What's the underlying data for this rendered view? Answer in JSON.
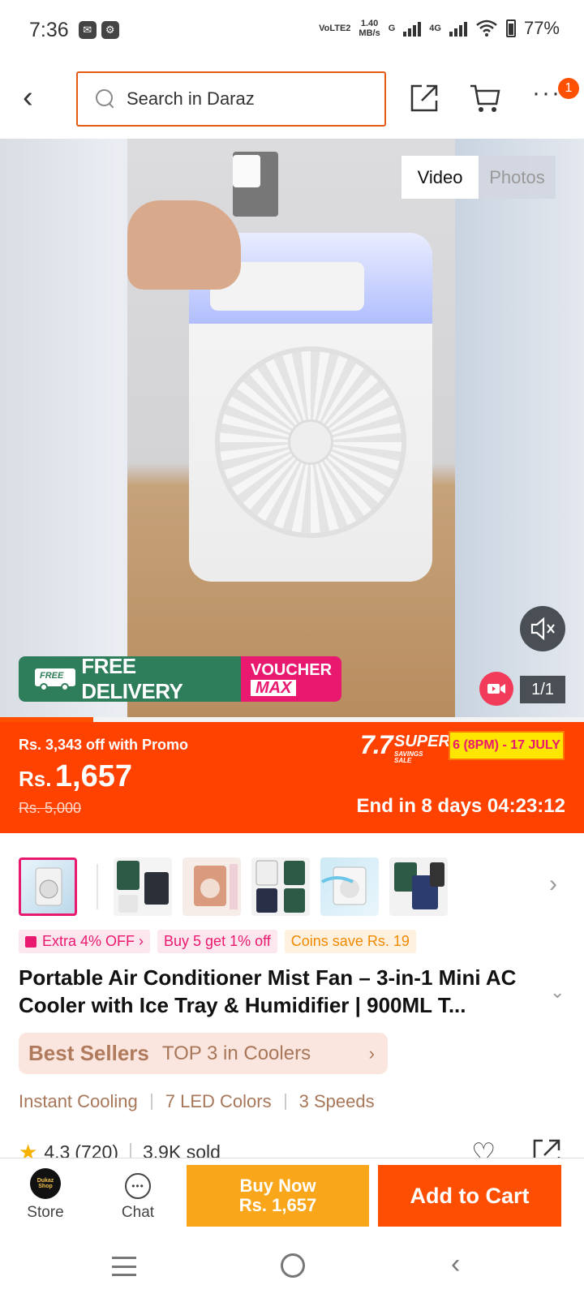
{
  "status_bar": {
    "time": "7:36",
    "volte": "VoLTE2",
    "speed_value": "1.40",
    "speed_unit": "MB/s",
    "net_g": "G",
    "net_4g": "4G",
    "battery": "77%"
  },
  "header": {
    "search_placeholder": "Search in Daraz",
    "cart_badge": "1"
  },
  "media": {
    "tab_video": "Video",
    "tab_photos": "Photos",
    "counter": "1/1",
    "promo_free_truck_text": "FREE",
    "promo_free_label": "FREE DELIVERY",
    "promo_voucher_label": "VOUCHER",
    "promo_voucher_max": "MAX",
    "gallery_progress": 0.16
  },
  "price": {
    "promo_text": "Rs. 3,343 off with Promo",
    "currency": "Rs.",
    "current": "1,657",
    "original": "Rs. 5,000",
    "sale_number": "7.7",
    "sale_word": "SUPER",
    "sale_subtext": "SAVINGS SALE",
    "sale_dates": "6 (8PM) - 17 JULY",
    "countdown": "End in 8 days 04:23:12"
  },
  "tags": {
    "extra_off": "Extra 4% OFF ›",
    "bulk": "Buy 5 get 1% off",
    "coins": "Coins save Rs. 19"
  },
  "product": {
    "title": "Portable Air Conditioner Mist Fan – 3-in-1 Mini AC Cooler with Ice Tray & Humidifier | 900ML T...",
    "bestseller_label": "Best Sellers",
    "bestseller_rank": "TOP 3 in Coolers",
    "features": [
      "Instant Cooling",
      "7 LED Colors",
      "3 Speeds"
    ],
    "rating": "4.3",
    "reviews": "(720)",
    "sold": "3.9K sold"
  },
  "action_bar": {
    "store_label": "Store",
    "store_logo_text": "Dukaz Shop",
    "chat_label": "Chat",
    "buy_now_label": "Buy Now",
    "buy_now_price": "Rs. 1,657",
    "add_to_cart_label": "Add to Cart"
  },
  "colors": {
    "brand_orange": "#ff4200",
    "accent_pink": "#e9196f",
    "buy_now": "#faa61a",
    "free_delivery_green": "#2e7d5b"
  }
}
